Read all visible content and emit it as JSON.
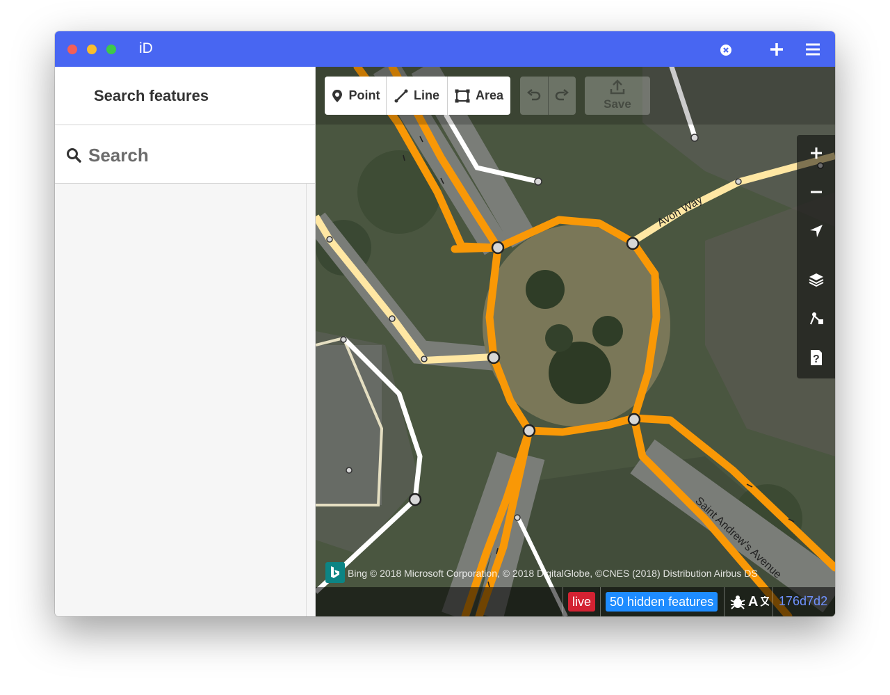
{
  "window": {
    "title": "iD"
  },
  "sidebar": {
    "header_title": "Search features",
    "search_placeholder": "Search"
  },
  "toolbar": {
    "modes": [
      {
        "label": "Point",
        "icon": "point-icon"
      },
      {
        "label": "Line",
        "icon": "line-icon"
      },
      {
        "label": "Area",
        "icon": "area-icon"
      }
    ],
    "undo_icon": "undo-icon",
    "redo_icon": "redo-icon",
    "save_label": "Save"
  },
  "map_controls": [
    "zoom-in-icon",
    "zoom-out-icon",
    "geolocate-icon",
    "layers-icon",
    "map-data-icon",
    "help-icon"
  ],
  "map": {
    "road_labels": [
      "Avon Way",
      "Saint Andrew's Avenue"
    ]
  },
  "footer": {
    "attribution": "Bing  © 2018 Microsoft Corporation, © 2018 DigitalGlobe, ©CNES (2018) Distribution Airbus DS",
    "live_badge": "live",
    "hidden_features": "50 hidden features",
    "language_label": "A",
    "version": "176d7d2"
  },
  "colors": {
    "titlebar": "#4866f2",
    "primary_road": "#f99806",
    "minor_road": "#ffeeaa",
    "hidden_badge": "#1e8cff",
    "live_badge": "#d32232"
  }
}
